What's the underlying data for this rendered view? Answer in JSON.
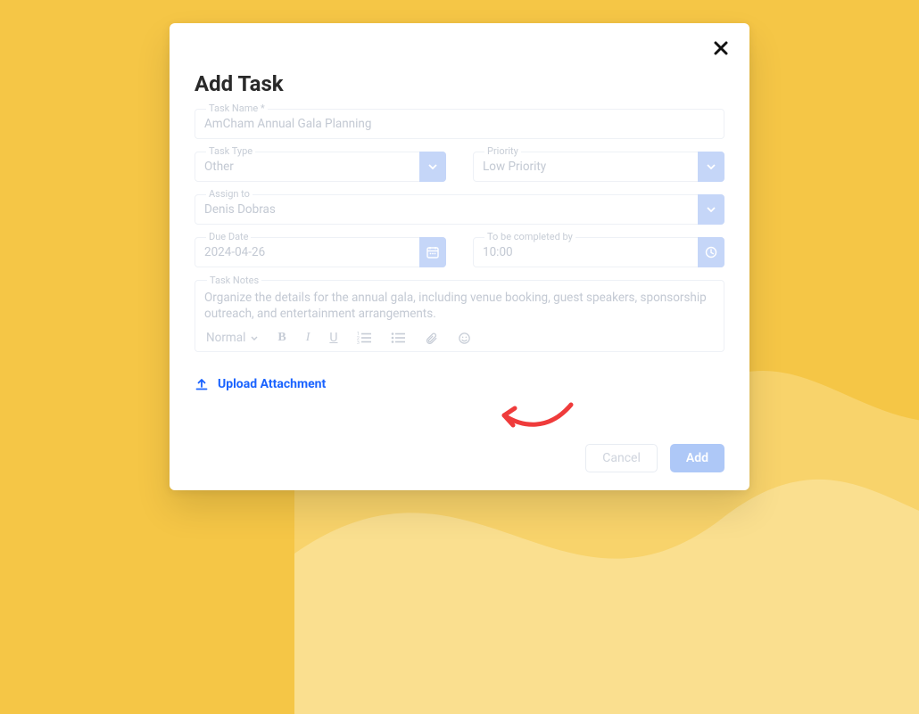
{
  "modal": {
    "title": "Add Task",
    "close_aria": "Close",
    "task_name": {
      "label": "Task Name *",
      "value": "AmCham Annual Gala Planning"
    },
    "task_type": {
      "label": "Task Type",
      "value": "Other"
    },
    "priority": {
      "label": "Priority",
      "value": "Low Priority"
    },
    "assign_to": {
      "label": "Assign to",
      "value": "Denis Dobras"
    },
    "due_date": {
      "label": "Due Date",
      "value": "2024-04-26"
    },
    "complete_by": {
      "label": "To be completed by",
      "value": "10:00"
    },
    "notes": {
      "label": "Task Notes",
      "value": "Organize the details for the annual gala, including venue booking, guest speakers, sponsorship outreach, and entertainment arrangements."
    },
    "editor_toolbar": {
      "format_label": "Normal"
    },
    "upload_label": "Upload Attachment",
    "buttons": {
      "cancel": "Cancel",
      "add": "Add"
    }
  }
}
